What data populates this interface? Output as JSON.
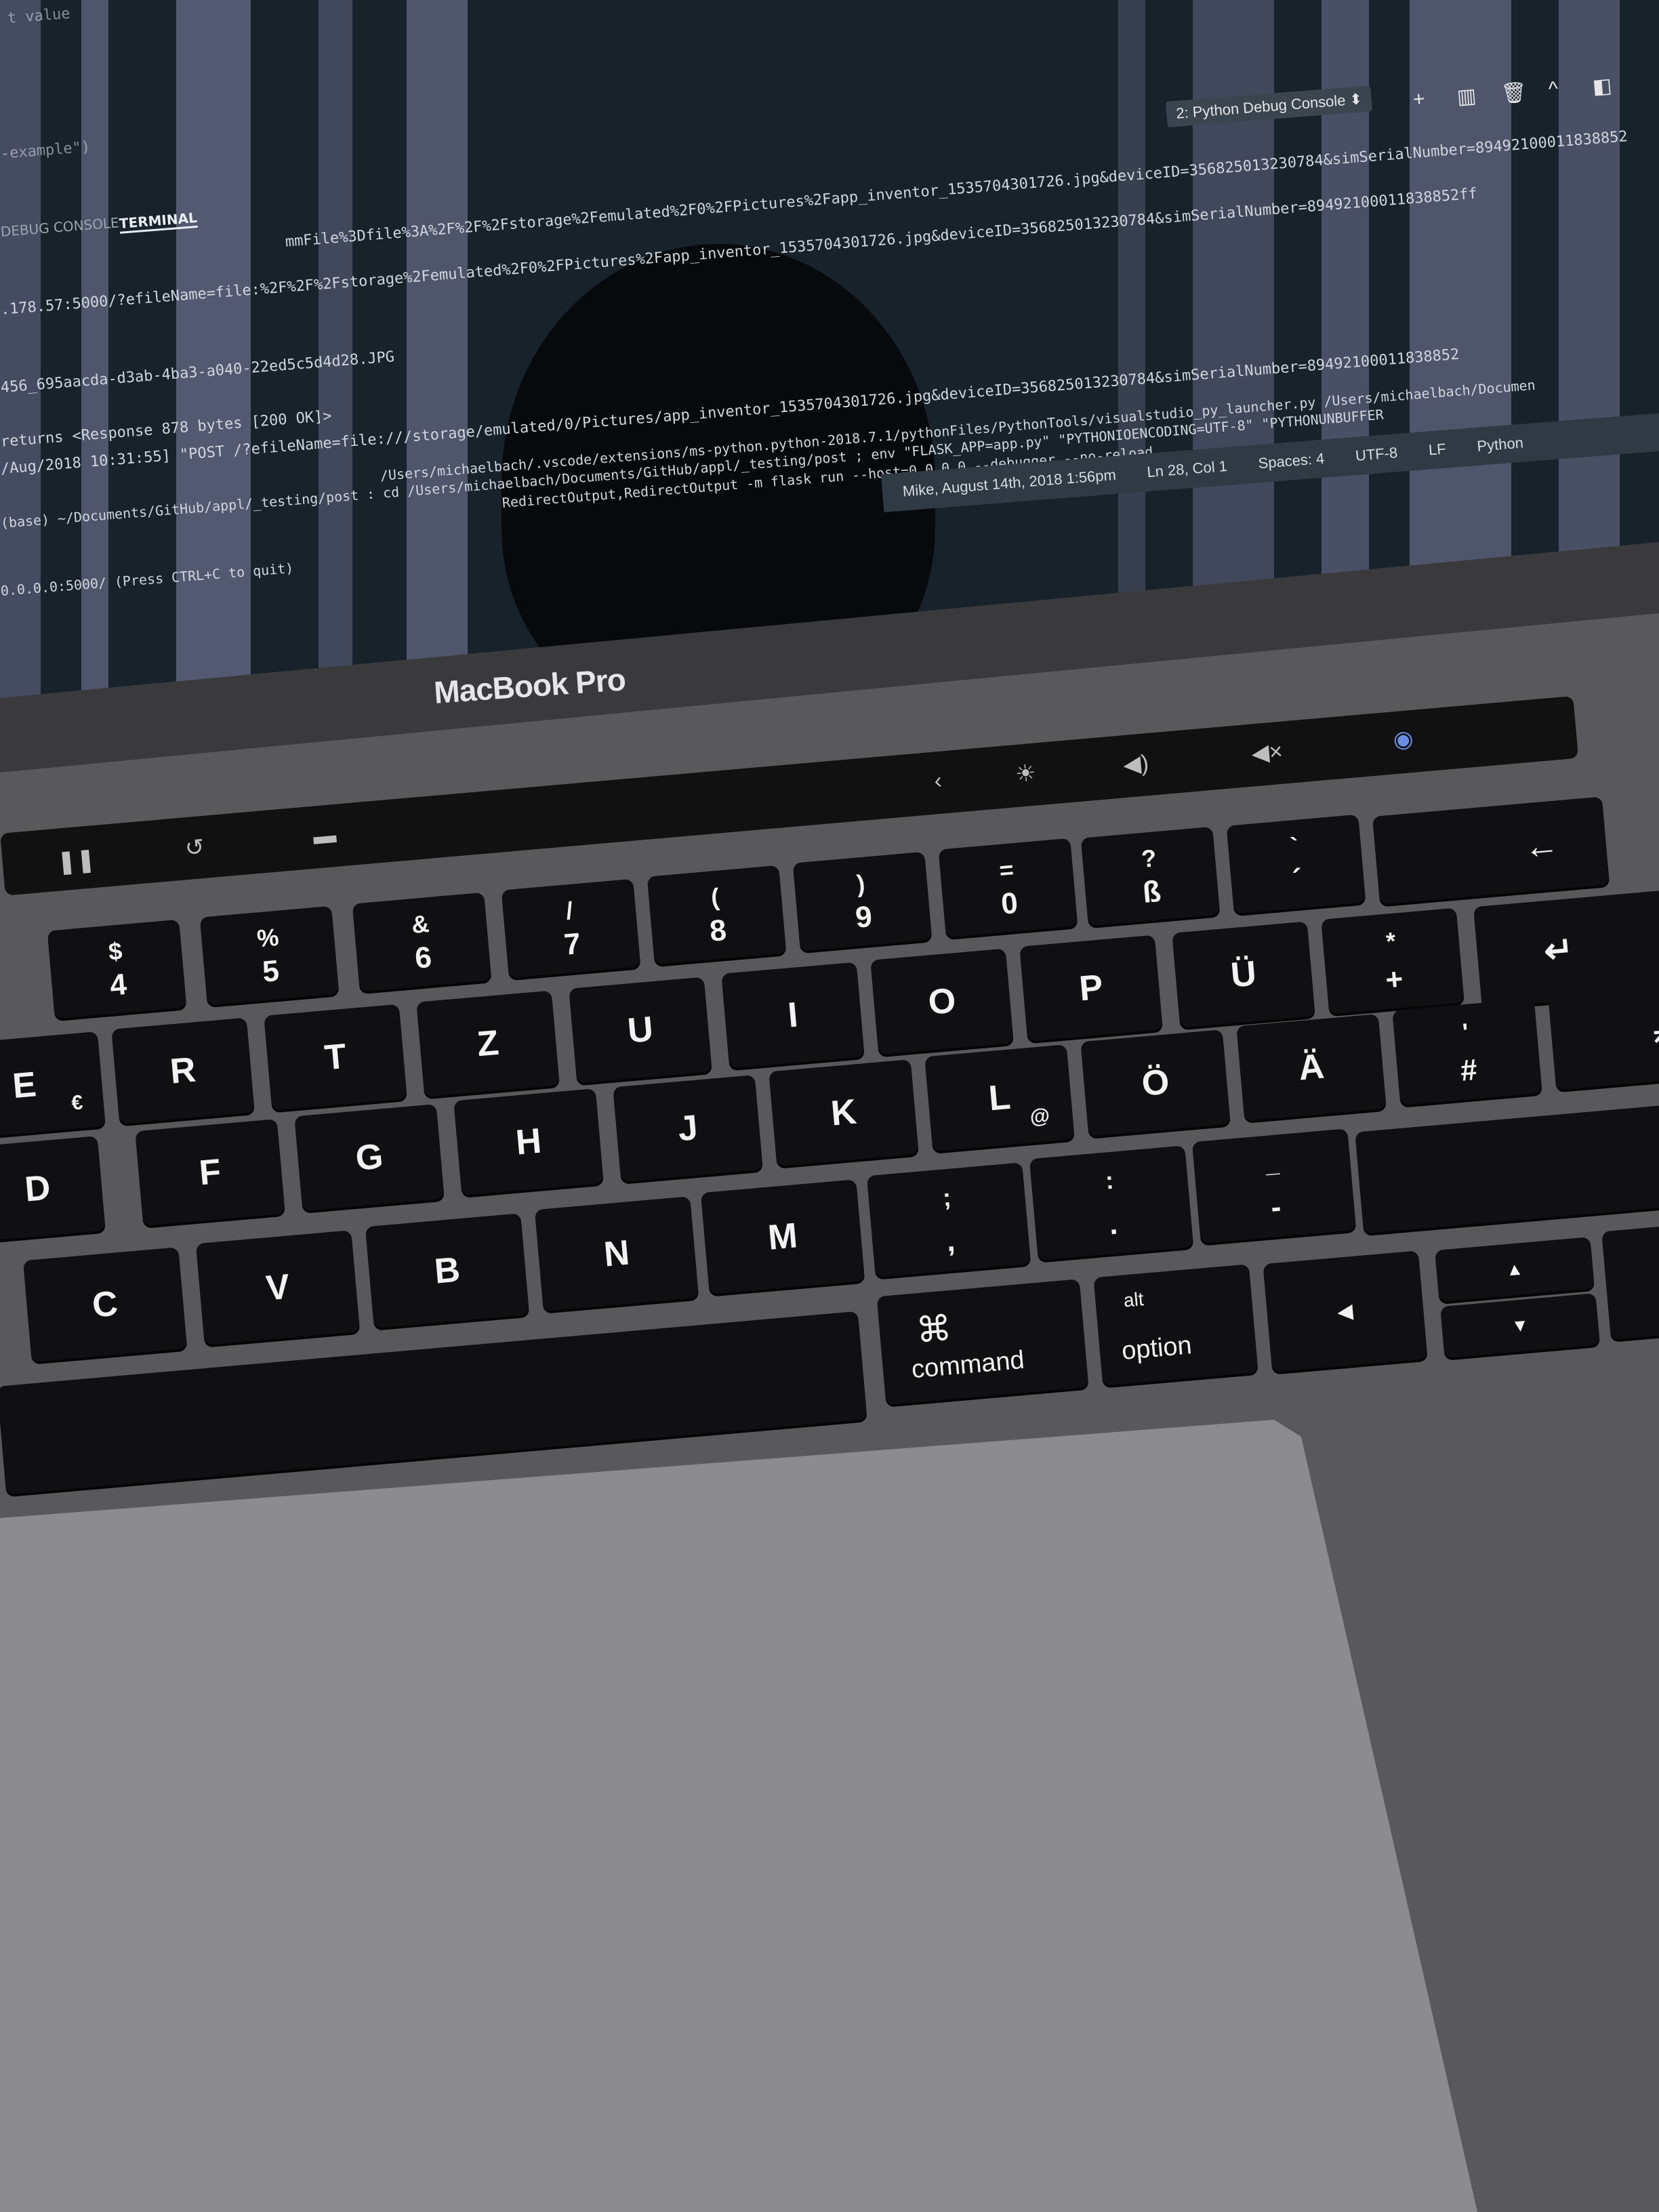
{
  "screen": {
    "tabs": [
      {
        "label": "DEBUG CONSOLE",
        "active": false
      },
      {
        "label": "TERMINAL",
        "active": true
      }
    ],
    "console_selector": "2: Python Debug Console",
    "terminal_lines": [
      "t value",
      "-example\")",
      "mmFile%3Dfile%3A%2F%2F%2Fstorage%2Femulated%2F0%2FPictures%2Fapp_inventor_1535704301726.jpg&deviceID=356825013230784&simSerialNumber=89492100011838852",
      ".178.57:5000/?efileName=file:%2F%2F%2Fstorage%2Femulated%2F0%2FPictures%2Fapp_inventor_1535704301726.jpg&deviceID=356825013230784&simSerialNumber=89492100011838852ff",
      "456_695aacda-d3ab-4ba3-a040-22ed5c5d4d28.JPG",
      "returns <Response 878 bytes [200 OK]>",
      "/Aug/2018 10:31:55] \"POST /?efileName=file:///storage/emulated/0/Pictures/app_inventor_1535704301726.jpg&deviceID=356825013230784&simSerialNumber=89492100011838852",
      "(base) ~/Documents/GitHub/appl/_testing/post : cd /Users/michaelbach/Documents/GitHub/appl/_testing/post ; env \"FLASK_APP=app.py\" \"PYTHONIOENCODING=UTF-8\" \"PYTHONUNBUFFER",
      "/Users/michaelbach/.vscode/extensions/ms-python.python-2018.7.1/pythonFiles/PythonTools/visualstudio_py_launcher.py /Users/michaelbach/Documen",
      "RedirectOutput,RedirectOutput -m flask run --host=0.0.0.0 --debugger --no-reload",
      "0.0.0.0:5000/ (Press CTRL+C to quit)"
    ],
    "status_bar": {
      "git": "Mike, August 14th, 2018 1:56pm",
      "position": "Ln 28, Col 1",
      "spaces": "Spaces: 4",
      "encoding": "UTF-8",
      "eol": "LF",
      "language": "Python"
    },
    "toolbar_icons": [
      "plus-icon",
      "split-icon",
      "trash-icon",
      "chevron-up-icon",
      "panel-icon"
    ]
  },
  "bezel": {
    "logo": "MacBook Pro"
  },
  "touchbar": {
    "icons": [
      "pause-icon",
      "undo-icon",
      "screen-icon",
      "chevron-left-icon",
      "brightness-icon",
      "volume-icon",
      "mute-icon",
      "siri-icon"
    ],
    "glyphs": [
      "❚❚",
      "↺",
      "▬",
      "‹",
      "☀",
      "◀)",
      "◀×",
      "◉"
    ]
  },
  "keyboard": {
    "row_numbers": [
      {
        "top": "$",
        "bot": "4"
      },
      {
        "top": "%",
        "bot": "5"
      },
      {
        "top": "&",
        "bot": "6"
      },
      {
        "top": "/",
        "bot": "7"
      },
      {
        "top": "(",
        "bot": "8"
      },
      {
        "top": ")",
        "bot": "9"
      },
      {
        "top": "=",
        "bot": "0"
      },
      {
        "top": "?",
        "bot": "ß"
      },
      {
        "top": "`",
        "bot": "´"
      }
    ],
    "backspace": "←",
    "row_qwertz": [
      "E",
      "R",
      "T",
      "Z",
      "U",
      "I",
      "O",
      "P",
      "Ü"
    ],
    "euro": "€",
    "plus_key": {
      "top": "*",
      "bot": "+"
    },
    "return_key": "↵",
    "row_home": [
      "D",
      "F",
      "G",
      "H",
      "J",
      "K",
      "L",
      "Ö",
      "Ä"
    ],
    "at_sign": "@",
    "hash_key": {
      "top": "'",
      "bot": "#"
    },
    "row_bottom": [
      "C",
      "V",
      "B",
      "N",
      "M"
    ],
    "semicolon_key": {
      "top": ";",
      "bot": ","
    },
    "colon_key": {
      "top": ":",
      "bot": "."
    },
    "underscore_key": {
      "top": "_",
      "bot": "-"
    },
    "command": {
      "glyph": "⌘",
      "label": "command"
    },
    "option": {
      "glyph": "alt",
      "label": "option"
    },
    "arrows": {
      "left": "◀",
      "up": "▲",
      "down": "▼"
    }
  }
}
